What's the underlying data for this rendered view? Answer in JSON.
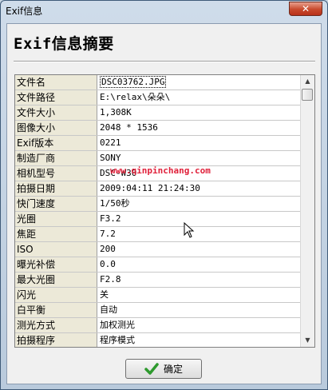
{
  "window": {
    "title": "Exif信息",
    "close_label": "✕"
  },
  "heading": "Exif信息摘要",
  "rows": [
    {
      "label": "文件名",
      "value": "DSC03762.JPG"
    },
    {
      "label": "文件路径",
      "value": "E:\\relax\\朵朵\\"
    },
    {
      "label": "文件大小",
      "value": "1,308K"
    },
    {
      "label": "图像大小",
      "value": "2048 * 1536"
    },
    {
      "label": "Exif版本",
      "value": "0221"
    },
    {
      "label": "制造厂商",
      "value": "SONY"
    },
    {
      "label": "相机型号",
      "value": "DSC-W30"
    },
    {
      "label": "拍摄日期",
      "value": "2009:04:11 21:24:30"
    },
    {
      "label": "快门速度",
      "value": "1/50秒"
    },
    {
      "label": "光圈",
      "value": "F3.2"
    },
    {
      "label": "焦距",
      "value": "7.2"
    },
    {
      "label": "ISO",
      "value": "200"
    },
    {
      "label": "曝光补偿",
      "value": "0.0"
    },
    {
      "label": "最大光圈",
      "value": "F2.8"
    },
    {
      "label": "闪光",
      "value": "关"
    },
    {
      "label": "白平衡",
      "value": "自动"
    },
    {
      "label": "测光方式",
      "value": "加权测光"
    },
    {
      "label": "拍摄程序",
      "value": "程序模式"
    }
  ],
  "watermark": "www.qinpinchang.com",
  "ok_button": {
    "label": "确定",
    "icon": "check-icon"
  },
  "colors": {
    "watermark": "#e0203a",
    "check": "#2e9a2e"
  }
}
